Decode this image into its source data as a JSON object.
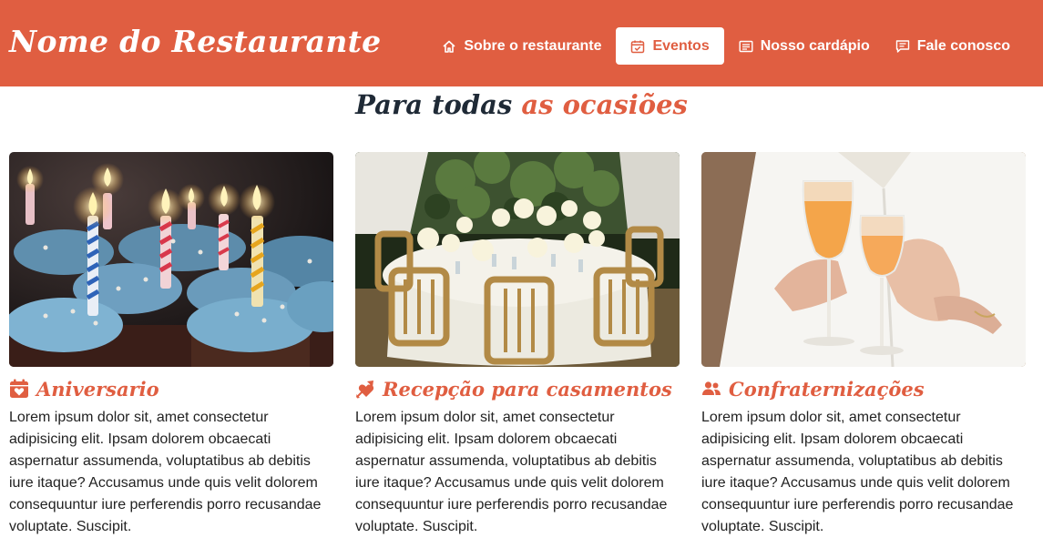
{
  "header": {
    "brand": "Nome do Restaurante",
    "nav": [
      {
        "label": "Sobre o restaurante",
        "icon": "home-icon"
      },
      {
        "label": "Eventos",
        "icon": "calendar-check-icon",
        "active": true
      },
      {
        "label": "Nosso cardápio",
        "icon": "menu-list-icon"
      },
      {
        "label": "Fale conosco",
        "icon": "chat-icon"
      }
    ]
  },
  "section": {
    "title_part1": "Para todas",
    "title_part2": "as ocasiões"
  },
  "cards": [
    {
      "title": "Aniversario",
      "icon": "calendar-heart-icon",
      "image": "birthday-cupcakes-candles",
      "text": "Lorem ipsum dolor sit, amet consectetur adipisicing elit. Ipsam dolorem obcaecati aspernatur assumenda, voluptatibus ab debitis iure itaque? Accusamus unde quis velit dolorem consequuntur iure perferendis porro recusandae voluptate. Suscipit."
    },
    {
      "title": "Recepção para casamentos",
      "icon": "heart-arrow-icon",
      "image": "wedding-reception-table",
      "text": "Lorem ipsum dolor sit, amet consectetur adipisicing elit. Ipsam dolorem obcaecati aspernatur assumenda, voluptatibus ab debitis iure itaque? Accusamus unde quis velit dolorem consequuntur iure perferendis porro recusandae voluptate. Suscipit."
    },
    {
      "title": "Confraternizações",
      "icon": "users-icon",
      "image": "glasses-toast",
      "text": "Lorem ipsum dolor sit, amet consectetur adipisicing elit. Ipsam dolorem obcaecati aspernatur assumenda, voluptatibus ab debitis iure itaque? Accusamus unde quis velit dolorem consequuntur iure perferendis porro recusandae voluptate. Suscipit."
    }
  ],
  "colors": {
    "accent": "#e05e41",
    "title_dark": "#1f2a36",
    "text": "#222222",
    "header_text": "#ffffff"
  }
}
